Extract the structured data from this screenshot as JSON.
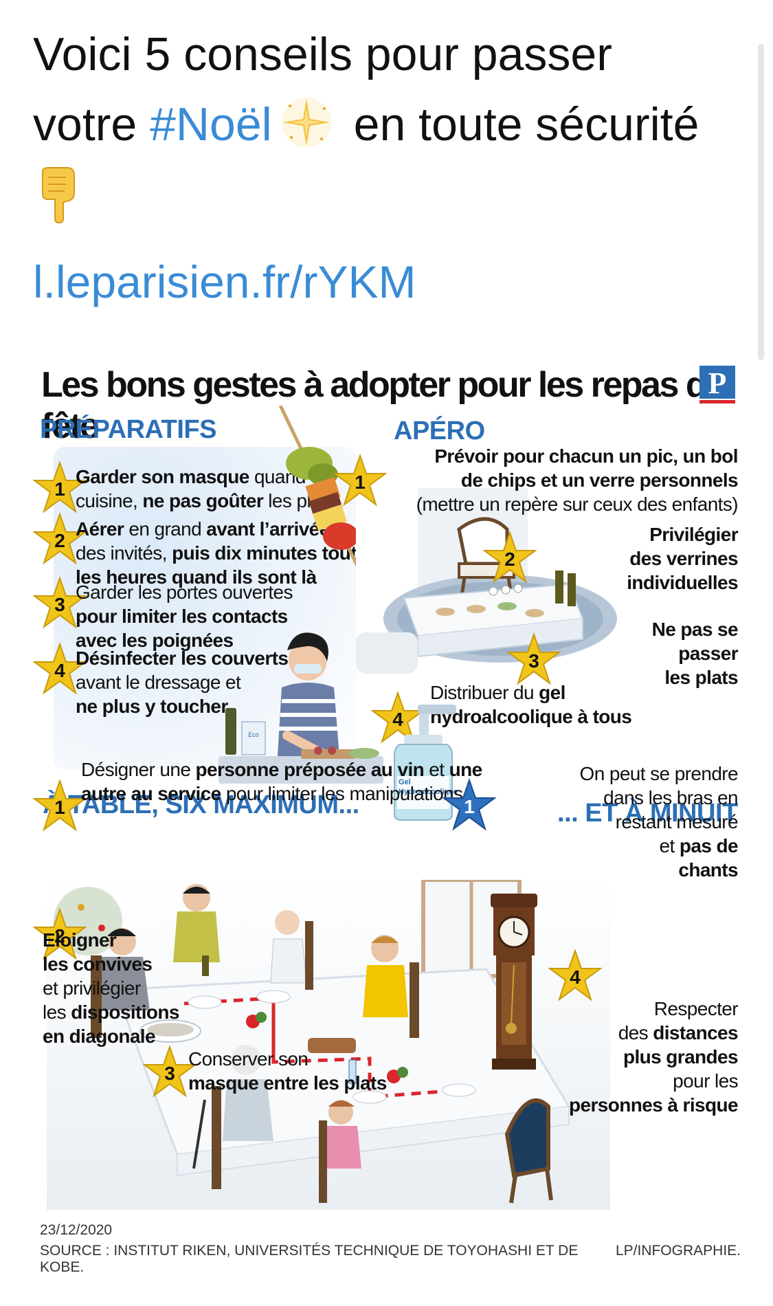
{
  "tweet": {
    "line1": "Voici 5 conseils pour passer",
    "line2_before": "votre ",
    "hashtag": "#Noël",
    "line2_after": " en toute sécurité",
    "link": "l.leparisien.fr/rYKM"
  },
  "icons": {
    "sparkle": "sparkles-icon",
    "pointer": "backhand-index-pointing-down-icon",
    "logo": "le-parisien-logo"
  },
  "colors": {
    "link": "#3a8bd6",
    "section": "#2c6fb5",
    "star": "#f0c419",
    "dashed": "#d9262c"
  },
  "infographic": {
    "title": "Les bons gestes à adopter pour les repas de fête",
    "preparatifs": {
      "heading": "PRÉPARATIFS",
      "tips": [
        {
          "num": "1",
          "html": "<b>Garder son masque</b> quand on<br>cuisine, <b>ne pas goûter</b> les plats"
        },
        {
          "num": "2",
          "html": "<b>Aérer</b> en grand <b>avant l’arrivée</b><br>des invités, <b>puis dix minutes toutes<br>les heures quand ils sont là</b>"
        },
        {
          "num": "3",
          "html": "Garder les portes ouvertes<br><b>pour limiter les contacts<br>avec les poignées</b>"
        },
        {
          "num": "4",
          "html": "<b>Désinfecter les couverts</b><br>avant le dressage et<br><b>ne plus y toucher</b>"
        }
      ]
    },
    "apero": {
      "heading": "APÉRO",
      "tips": [
        {
          "num": "1",
          "html": "<b>Prévoir pour chacun un pic, un bol<br>de chips et un verre personnels</b><br>(mettre un repère sur ceux des enfants)"
        },
        {
          "num": "2",
          "html": "<b>Privilégier<br>des verrines<br>individuelles</b>"
        },
        {
          "num": "3",
          "html": "<b>Ne pas se<br>passer<br>les plats</b>"
        },
        {
          "num": "4",
          "html": "Distribuer du <b>gel<br>hydroalcoolique à tous</b>"
        }
      ],
      "gel_label": "Gel Hydroalcoolique"
    },
    "table": {
      "heading": "À TABLE, SIX MAXIMUM...",
      "tips": [
        {
          "num": "1",
          "html": "Désigner une <b>personne préposée au vin</b> et <b>une<br>autre au service</b> pour limiter les manipulations"
        },
        {
          "num": "2",
          "html": "<b>Eloigner<br>les convives</b><br>et privilégier<br>les <b>dispositions<br>en diagonale</b>"
        },
        {
          "num": "3",
          "html": "Conserver son<br><b>masque entre les plats</b>"
        },
        {
          "num": "4",
          "html": "Respecter<br>des <b>distances<br>plus grandes</b><br>pour les<br><b>personnes à risque</b>"
        }
      ]
    },
    "minuit": {
      "heading": "... ET À MINUIT",
      "tips": [
        {
          "num": "1",
          "html": "On peut se prendre<br>dans les bras en<br>restant mesuré<br>et <b>pas de<br>chants</b>"
        }
      ]
    },
    "date": "23/12/2020",
    "source": "SOURCE : INSTITUT RIKEN, UNIVERSITÉS TECHNIQUE DE TOYOHASHI ET DE KOBE.",
    "credit": "LP/INFOGRAPHIE."
  }
}
